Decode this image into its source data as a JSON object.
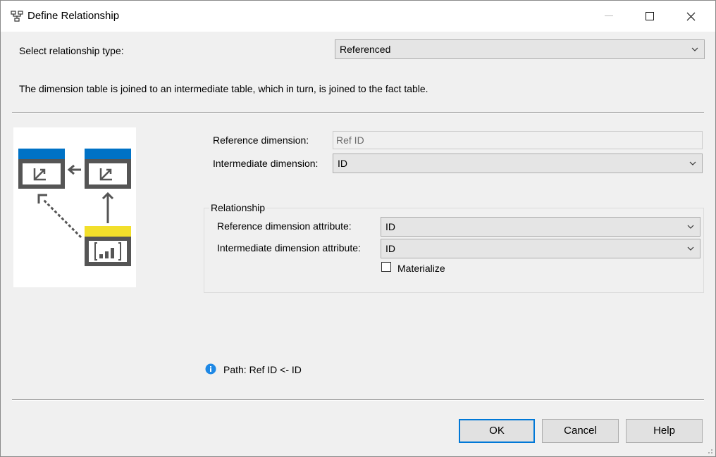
{
  "window": {
    "title": "Define Relationship",
    "icon": "relationship-icon",
    "controls": [
      "minimize-icon",
      "maximize-icon",
      "close-icon"
    ]
  },
  "relationship_type": {
    "label": "Select relationship type:",
    "value": "Referenced"
  },
  "description": "The dimension table is joined to an intermediate table, which in turn, is joined to the fact table.",
  "reference_dimension": {
    "label": "Reference dimension:",
    "value": "Ref ID"
  },
  "intermediate_dimension": {
    "label": "Intermediate dimension:",
    "value": "ID"
  },
  "relationship_group": {
    "title": "Relationship",
    "reference_attribute": {
      "label": "Reference dimension attribute:",
      "value": "ID"
    },
    "intermediate_attribute": {
      "label": "Intermediate dimension attribute:",
      "value": "ID"
    },
    "materialize": {
      "label": "Materialize",
      "checked": false
    }
  },
  "path": "Path: Ref ID <- ID",
  "buttons": {
    "ok": "OK",
    "cancel": "Cancel",
    "help": "Help"
  },
  "colors": {
    "dimension_header": "#0072c6",
    "fact_header": "#f2df2b",
    "diagram_stroke": "#555555",
    "default_button_border": "#0078d7",
    "info_icon": "#1e88e5"
  }
}
